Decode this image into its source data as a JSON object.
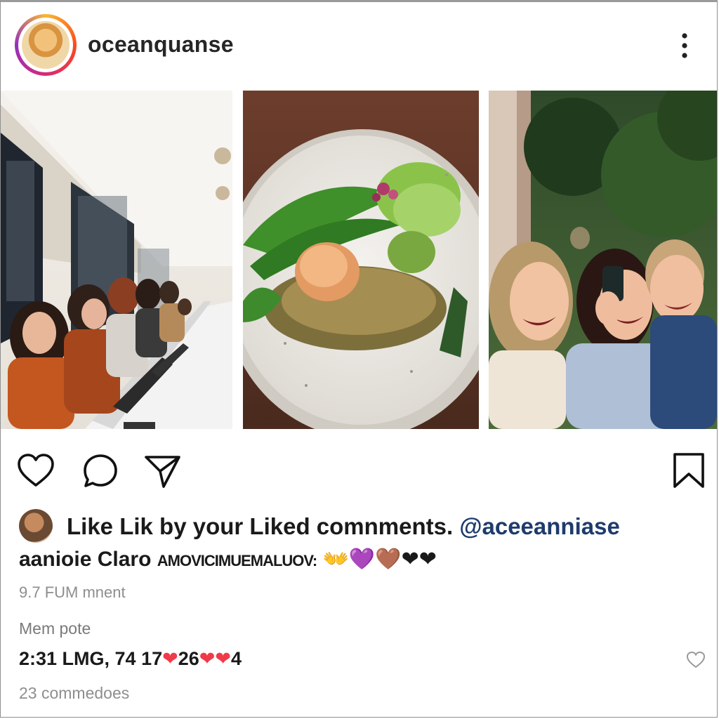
{
  "post": {
    "username": "oceanquanse",
    "liked_by_prefix": "Like Lik  by your Liked comnments.",
    "liked_by_mention": "@aceeanniase",
    "caption_author": "aanioie Claro",
    "caption_text": "AMOVICIMUEMALUOV:",
    "caption_emojis": "👐💜🤎❤❤",
    "timestamp": "9.7 FUM mnent",
    "more_label": "Mem pote",
    "stats_text": "2:31 LMG, 74 17",
    "stats_heart_1": "❤",
    "stats_mid": "26",
    "stats_heart_2": "❤❤",
    "stats_suffix": "4",
    "comments_link": "23 commedoes"
  },
  "icons": {
    "header_more": "more-vertical-icon",
    "like": "heart-icon",
    "comment": "comment-bubble-icon",
    "share": "paper-plane-icon",
    "save": "bookmark-icon",
    "comment_like": "small-heart-icon"
  },
  "images": [
    {
      "subject": "people-working-at-long-counter"
    },
    {
      "subject": "plated-food-with-greens"
    },
    {
      "subject": "laughing-friends-with-phone"
    }
  ],
  "colors": {
    "text": "#1a1a1a",
    "muted": "#8e8e8e",
    "mention": "#1f3b6d",
    "heart_red": "#f03a4a",
    "ring_gradient": [
      "#f7b733",
      "#fc4a1a",
      "#d62976",
      "#962fbf"
    ]
  }
}
